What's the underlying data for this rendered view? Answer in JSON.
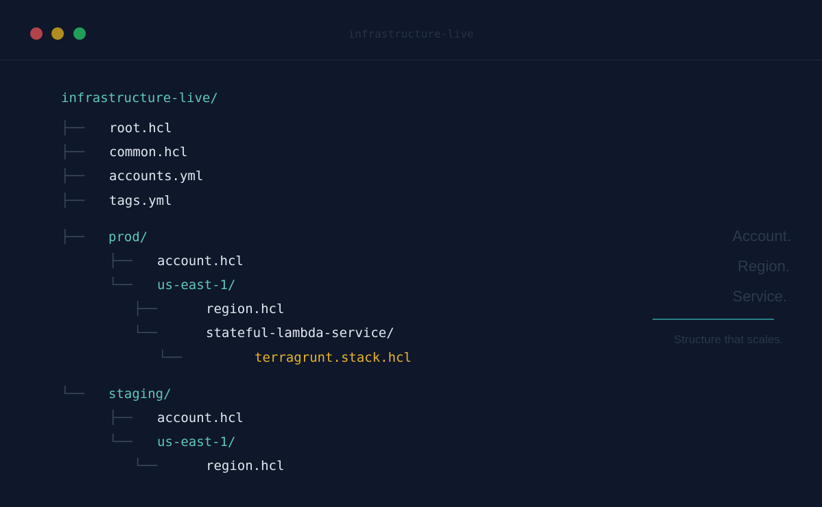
{
  "window": {
    "title": "infrastructure-live",
    "controls": {
      "close_color": "#b3434b",
      "minimize_color": "#b08d1e",
      "maximize_color": "#219e58"
    }
  },
  "tree": {
    "root": "infrastructure-live/",
    "branch_mid": "├──",
    "branch_last": "└──",
    "items": [
      {
        "label": "root.hcl",
        "kind": "file"
      },
      {
        "label": "common.hcl",
        "kind": "file"
      },
      {
        "label": "accounts.yml",
        "kind": "file"
      },
      {
        "label": "tags.yml",
        "kind": "file"
      },
      {
        "label": "prod/",
        "kind": "dir"
      },
      {
        "label": "account.hcl",
        "kind": "file"
      },
      {
        "label": "us-east-1/",
        "kind": "dir"
      },
      {
        "label": "region.hcl",
        "kind": "file"
      },
      {
        "label": "stateful-lambda-service/",
        "kind": "file"
      },
      {
        "label": "terragrunt.stack.hcl",
        "kind": "stack"
      },
      {
        "label": "staging/",
        "kind": "dir"
      },
      {
        "label": "account.hcl",
        "kind": "file"
      },
      {
        "label": "us-east-1/",
        "kind": "dir"
      },
      {
        "label": "region.hcl",
        "kind": "file"
      }
    ]
  },
  "sidebar": {
    "words": [
      "Account.",
      "Region.",
      "Service."
    ],
    "tagline": "Structure that scales.",
    "accent_color": "#2a7f86"
  },
  "colors": {
    "background": "#0f172a",
    "file": "#e2e8f0",
    "dir": "#5ec8bb",
    "stack": "#e8b42b"
  }
}
